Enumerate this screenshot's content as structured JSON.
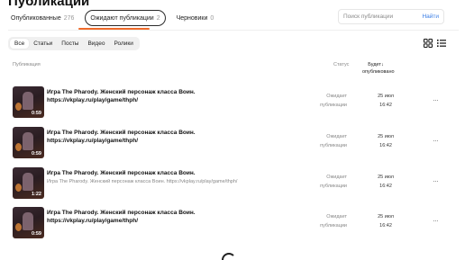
{
  "page": {
    "title": "Публикации"
  },
  "tabs": [
    {
      "label": "Опубликованные",
      "count": "276"
    },
    {
      "label": "Ожидают публикации",
      "count": "2"
    },
    {
      "label": "Черновики",
      "count": "0"
    }
  ],
  "search": {
    "placeholder": "Поиск публикации",
    "button": "Найти"
  },
  "filters": [
    "Все",
    "Статьи",
    "Посты",
    "Видео",
    "Ролики"
  ],
  "table": {
    "col_publication": "Публикация",
    "col_status": "Статус",
    "col_date": "Будет↓ опубликовано"
  },
  "rows": [
    {
      "title": "Игра The Pharody. Женский персонаж класса Воин.",
      "subtitle": "https://vkplay.ru/play/game/thph/",
      "duration": "0:59",
      "status_line1": "Ожидает",
      "status_line2": "публикации",
      "date": "25 июл",
      "time": "16:42",
      "more": "···"
    },
    {
      "title": "Игра The Pharody. Женский персонаж класса Воин.",
      "subtitle": "https://vkplay.ru/play/game/thph/",
      "duration": "0:59",
      "status_line1": "Ожидает",
      "status_line2": "публикации",
      "date": "25 июл",
      "time": "16:42",
      "more": "···"
    },
    {
      "title": "Игра The Pharody. Женский персонаж класса Воин.",
      "subtitle": "Игра The Pharody. Женский персонаж класса Воин. https://vkplay.ru/play/game/thph/",
      "duration": "1:22",
      "status_line1": "Ожидает",
      "status_line2": "публикации",
      "date": "25 июл",
      "time": "16:42",
      "more": "···"
    },
    {
      "title": "Игра The Pharody. Женский персонаж класса Воин.",
      "subtitle": "https://vkplay.ru/play/game/thph/",
      "duration": "0:59",
      "status_line1": "Ожидает",
      "status_line2": "публикации",
      "date": "25 июл",
      "time": "16:42",
      "more": "···"
    }
  ],
  "colors": {
    "accent": "#ef6a2a",
    "link": "#3a7ee6"
  },
  "icons": {
    "grid_view": "grid-view-icon",
    "list_view": "list-view-icon",
    "loader": "loading-spinner-icon"
  }
}
